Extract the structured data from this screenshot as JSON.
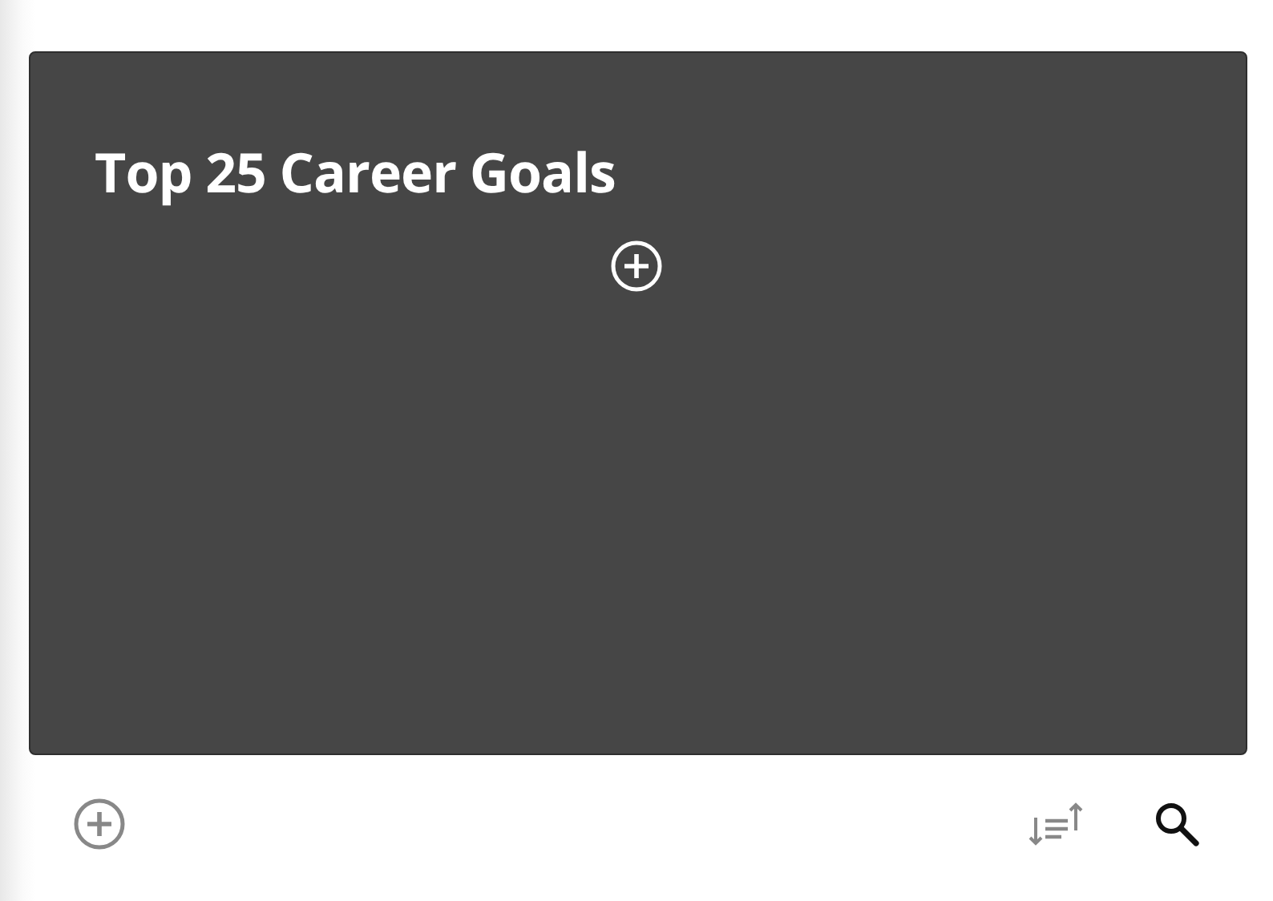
{
  "card": {
    "title": "Top 25 Career Goals"
  }
}
